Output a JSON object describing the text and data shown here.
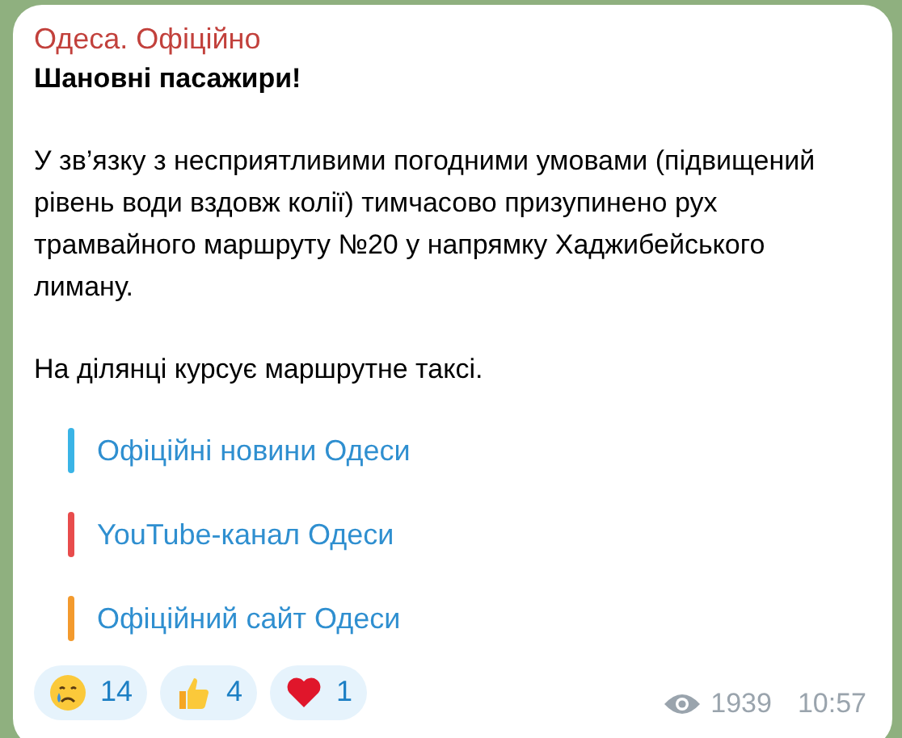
{
  "message": {
    "sender": "Одеса. Офіційно",
    "title": "Шановні пасажири!",
    "paragraphs": [
      "У зв’язку з несприятливими погодними умовами (підвищений рівень води вздовж колії) тимчасово призупинено рух трамвайного маршруту №20 у напрямку Хаджибейського лиману.",
      "На ділянці курсує маршрутне таксі."
    ],
    "links": [
      {
        "label": "Офіційні новини Одеси",
        "color": "#3ab4e6"
      },
      {
        "label": "YouTube-канал Одеси",
        "color": "#e84c4c"
      },
      {
        "label": "Офіційний сайт Одеси",
        "color": "#f39a2d"
      }
    ],
    "reactions": [
      {
        "kind": "crying",
        "count": "14"
      },
      {
        "kind": "thumbs-up",
        "count": "4"
      },
      {
        "kind": "heart",
        "count": "1"
      }
    ],
    "views": "1939",
    "time": "10:57"
  }
}
